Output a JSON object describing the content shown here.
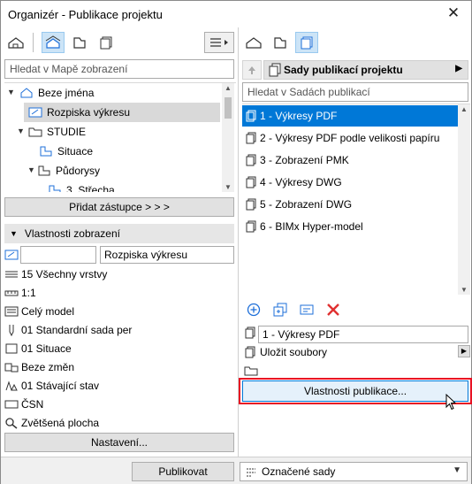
{
  "window": {
    "title": "Organizér - Publikace projektu",
    "close_label": "✕"
  },
  "left": {
    "search_placeholder": "Hledat v Mapě zobrazení",
    "tree": [
      {
        "label": "Beze jména"
      },
      {
        "label": "Rozpiska výkresu"
      },
      {
        "label": "STUDIE"
      },
      {
        "label": "Situace"
      },
      {
        "label": "Půdorysy"
      },
      {
        "label": "3. Střecha"
      }
    ],
    "add_button": "Přidat zástupce > > >",
    "props_header": "Vlastnosti zobrazení",
    "view_id_value": "",
    "view_name_value": "Rozpiska výkresu",
    "props": [
      {
        "label": "15 Všechny vrstvy",
        "icon": "layers-icon"
      },
      {
        "label": "1:1",
        "icon": "scale-icon"
      },
      {
        "label": "Celý model",
        "icon": "model-icon"
      },
      {
        "label": "01 Standardní sada per",
        "icon": "pen-icon"
      },
      {
        "label": "01 Situace",
        "icon": "display-icon"
      },
      {
        "label": "Beze změn",
        "icon": "override-icon"
      },
      {
        "label": "01 Stávající stav",
        "icon": "renovation-icon"
      },
      {
        "label": "ČSN",
        "icon": "dimension-icon"
      },
      {
        "label": "Zvětšená plocha",
        "icon": "zoom-icon"
      }
    ],
    "settings_button": "Nastavení..."
  },
  "right": {
    "set_dropdown": "Sady publikací projektu",
    "search_placeholder": "Hledat v Sadách publikací",
    "sets": [
      {
        "label": "1 - Výkresy PDF"
      },
      {
        "label": "2 - Výkresy PDF podle velikosti papíru"
      },
      {
        "label": "3 - Zobrazení PMK"
      },
      {
        "label": "4 - Výkresy DWG"
      },
      {
        "label": "5 - Zobrazení DWG"
      },
      {
        "label": "6 - BIMx Hyper-model"
      }
    ],
    "set_name_value": "1 - Výkresy PDF",
    "save_files_label": "Uložit soubory",
    "folder_value": "",
    "properties_button": "Vlastnosti publikace..."
  },
  "bottom": {
    "publish_button": "Publikovat",
    "scope_value": "Označené sady"
  },
  "colors": {
    "selection": "#0078d7",
    "highlight_border": "#e81123",
    "delete_red": "#e03131",
    "icon_blue": "#1e6fd9"
  }
}
